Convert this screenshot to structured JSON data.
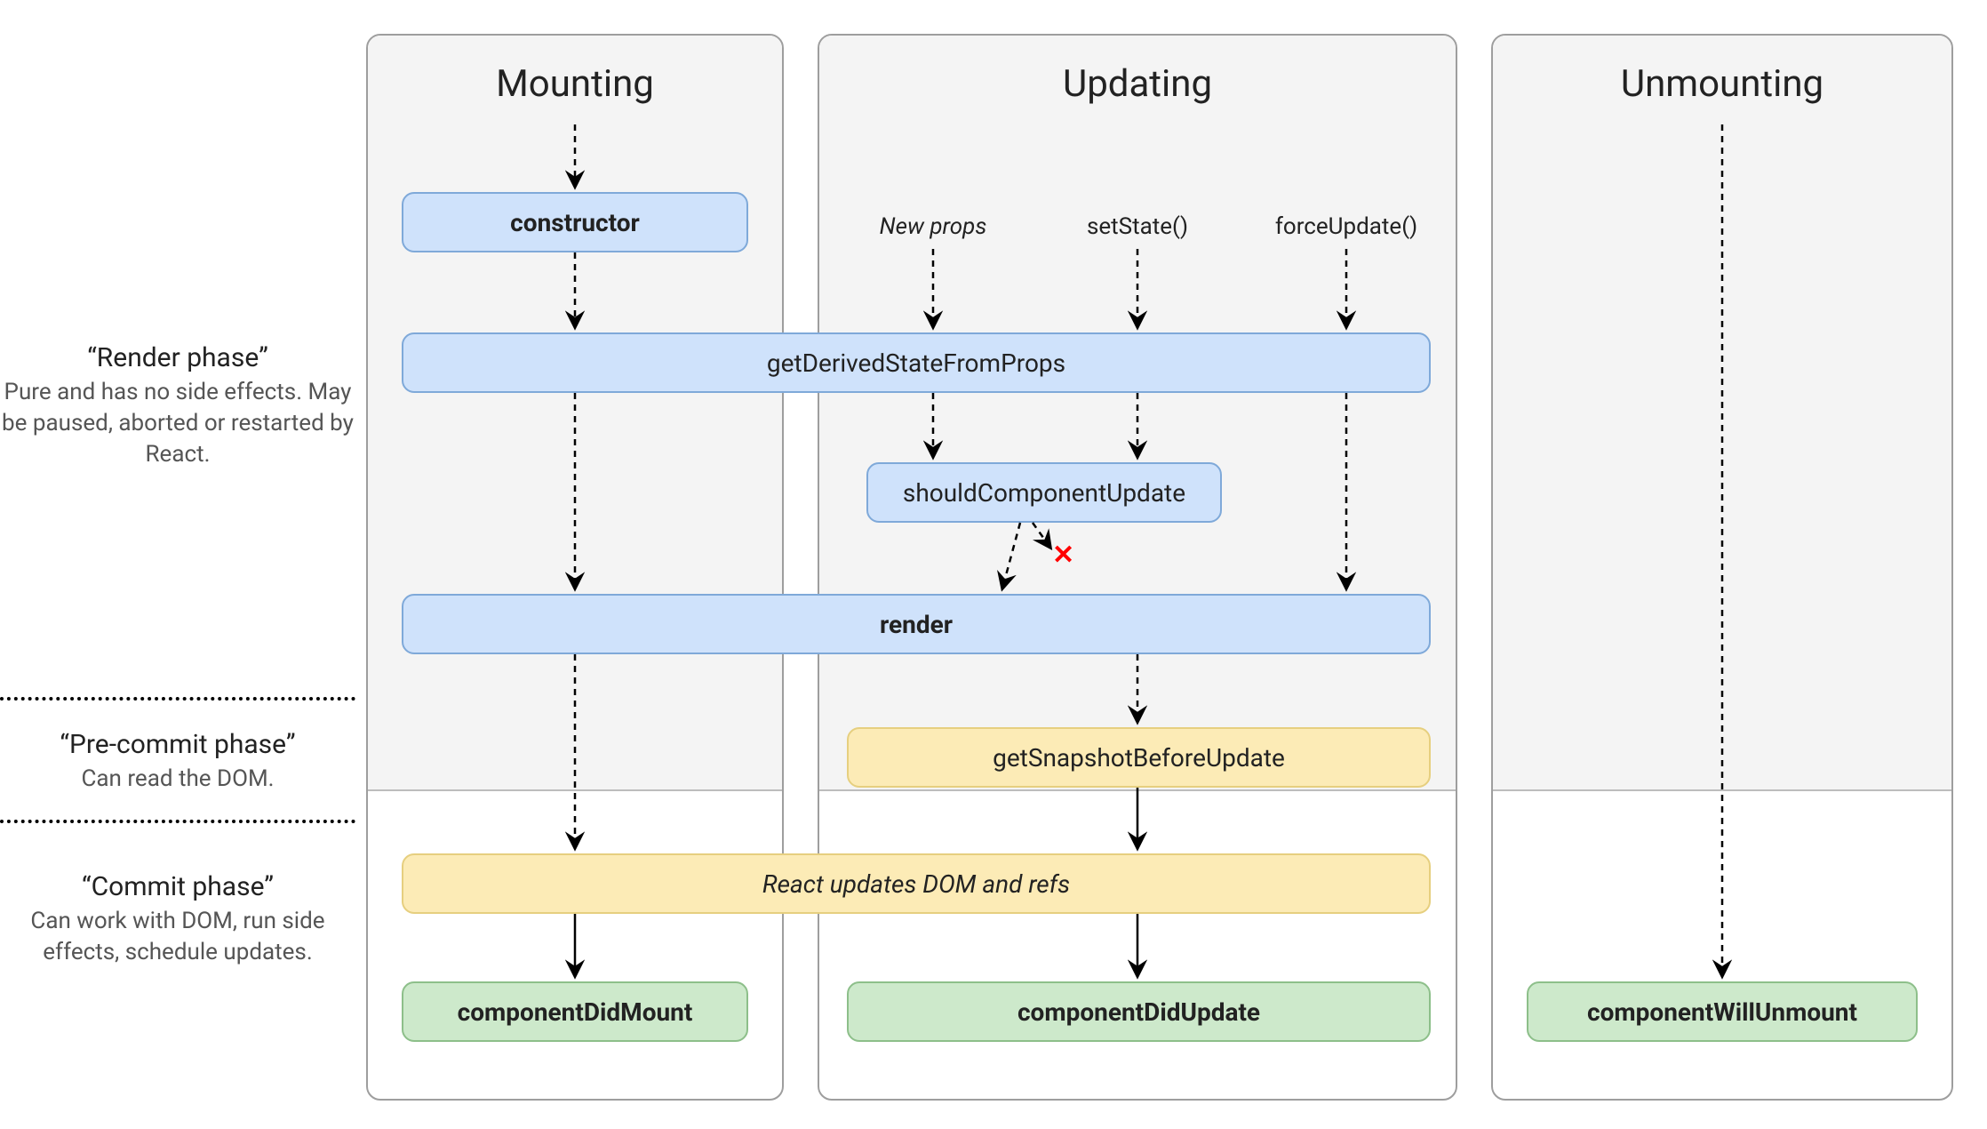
{
  "columns": {
    "mounting": {
      "title": "Mounting"
    },
    "updating": {
      "title": "Updating"
    },
    "unmounting": {
      "title": "Unmounting"
    }
  },
  "triggers": {
    "new_props": "New props",
    "set_state": "setState()",
    "force_update": "forceUpdate()"
  },
  "boxes": {
    "constructor": "constructor",
    "getDerivedStateFromProps": "getDerivedStateFromProps",
    "shouldComponentUpdate": "shouldComponentUpdate",
    "render": "render",
    "getSnapshotBeforeUpdate": "getSnapshotBeforeUpdate",
    "reactUpdatesDom": "React updates DOM and refs",
    "componentDidMount": "componentDidMount",
    "componentDidUpdate": "componentDidUpdate",
    "componentWillUnmount": "componentWillUnmount"
  },
  "phases": {
    "render": {
      "title": "“Render phase”",
      "desc": "Pure and has no side effects. May be paused, aborted or restarted by React."
    },
    "precommit": {
      "title": "“Pre-commit phase”",
      "desc": "Can read the DOM."
    },
    "commit": {
      "title": "“Commit phase”",
      "desc": "Can work with DOM, run side effects, schedule updates."
    }
  },
  "cancel_mark": "✕"
}
